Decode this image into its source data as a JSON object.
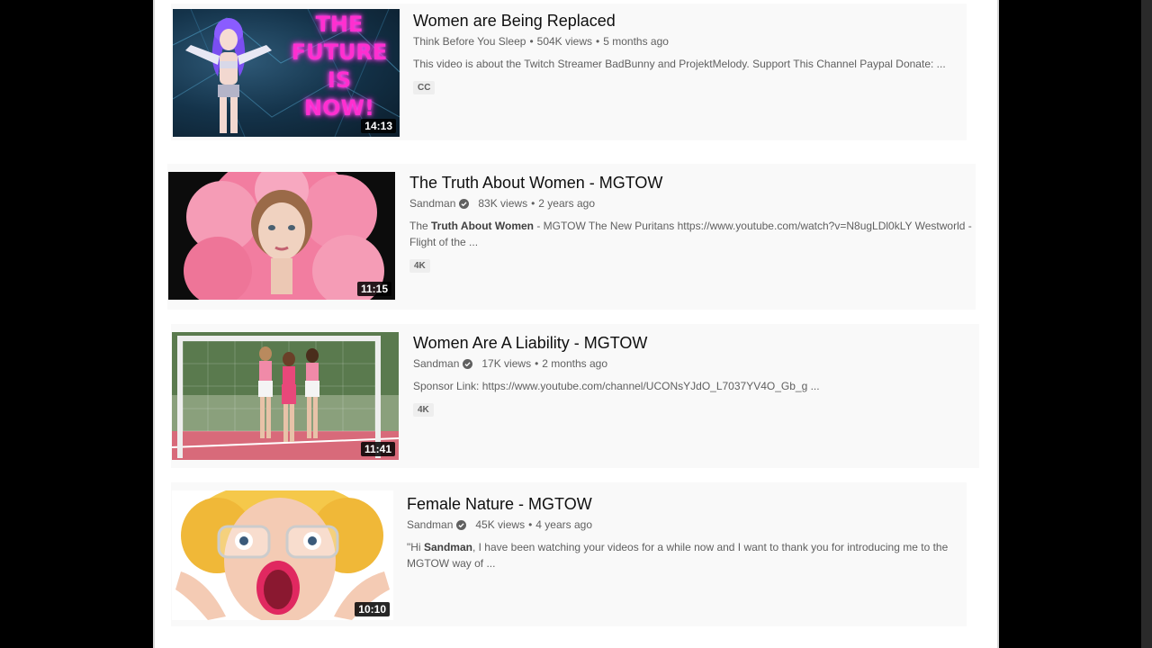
{
  "results": [
    {
      "title": "Women are Being Replaced",
      "channel": "Think Before You Sleep",
      "verified": false,
      "views": "504K views",
      "age": "5 months ago",
      "description": "This video is about the Twitch Streamer BadBunny and ProjektMelody. Support This Channel Paypal Donate: ...",
      "badge": "CC",
      "duration": "14:13",
      "thumb_text": [
        "THE",
        "FUTURE",
        "IS",
        "NOW!"
      ]
    },
    {
      "title": "The Truth About Women - MGTOW",
      "channel": "Sandman",
      "verified": true,
      "views": "83K views",
      "age": "2 years ago",
      "description_pre": "The ",
      "description_bold": "Truth About Women",
      "description_post": " - MGTOW The New Puritans https://www.youtube.com/watch?v=N8ugLDl0kLY Westworld - Flight of the ...",
      "badge": "4K",
      "duration": "11:15"
    },
    {
      "title": "Women Are A Liability - MGTOW",
      "channel": "Sandman",
      "verified": true,
      "views": "17K views",
      "age": "2 months ago",
      "description": "Sponsor Link: https://www.youtube.com/channel/UCONsYJdO_L7037YV4O_Gb_g ...",
      "badge": "4K",
      "duration": "11:41"
    },
    {
      "title": "Female Nature - MGTOW",
      "channel": "Sandman",
      "verified": true,
      "views": "45K views",
      "age": "4 years ago",
      "description_pre": "\"Hi ",
      "description_bold": "Sandman",
      "description_post": ", I have been watching your videos for a while now and I want to thank you for introducing me to the MGTOW way of ...",
      "duration": "10:10"
    }
  ],
  "separator": "•",
  "icons": {
    "verified": "verified-check-icon"
  },
  "colors": {
    "title": "#0f0f0f",
    "meta": "#606060",
    "result_bg": "#f9f9f9"
  }
}
